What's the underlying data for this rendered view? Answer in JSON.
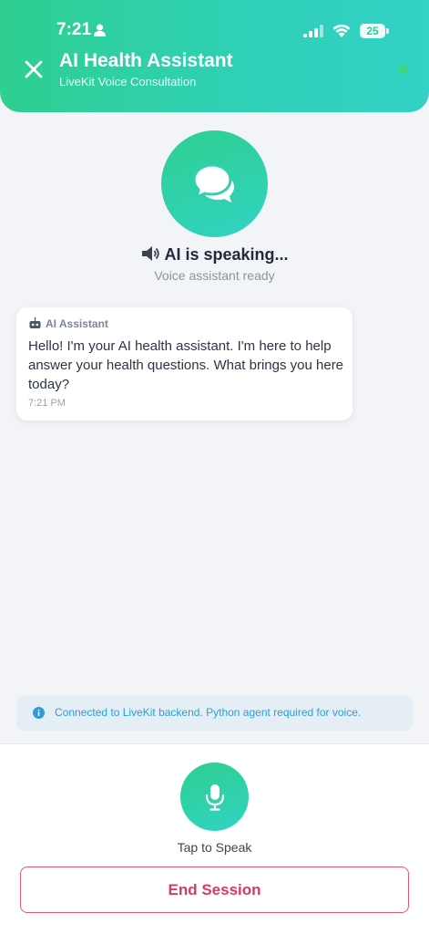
{
  "status_bar": {
    "time": "7:21",
    "battery": "25"
  },
  "header": {
    "title": "AI Health Assistant",
    "subtitle": "LiveKit Voice Consultation",
    "status_color": "#3fd57a"
  },
  "assistant": {
    "speaking_text": "AI is speaking...",
    "ready_text": "Voice assistant ready"
  },
  "messages": [
    {
      "sender": "AI Assistant",
      "text": "Hello! I'm your AI health assistant. I'm here to help answer your health questions. What brings you here today?",
      "time": "7:21 PM"
    }
  ],
  "info_bar": {
    "text": "Connected to LiveKit backend. Python agent required for voice."
  },
  "controls": {
    "tap_label": "Tap to Speak",
    "end_session_label": "End Session"
  },
  "colors": {
    "accent_start": "#2ecf8f",
    "accent_end": "#33d1c6",
    "danger": "#d93a5e",
    "info": "#2a9ed6"
  }
}
